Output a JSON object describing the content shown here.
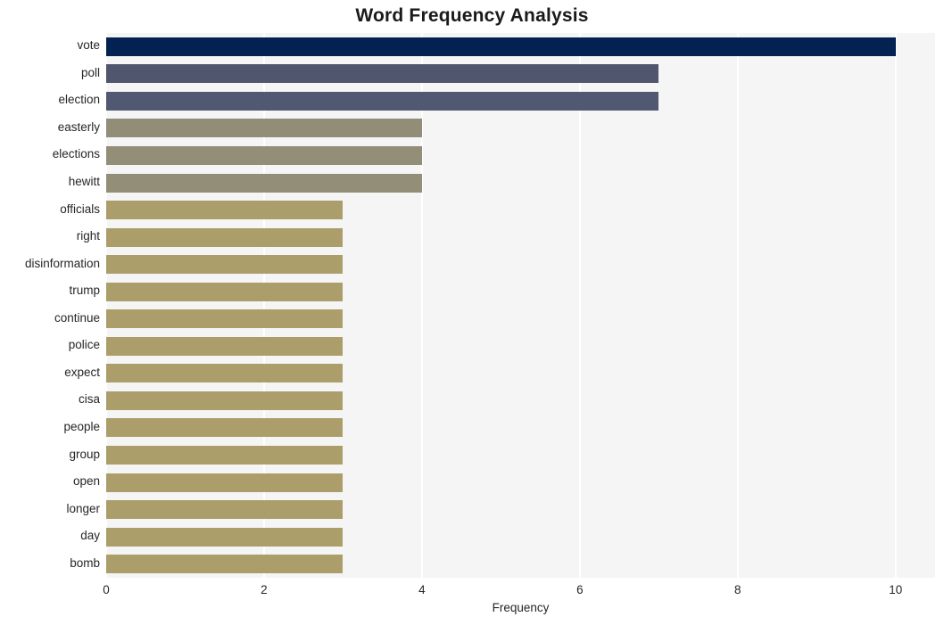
{
  "chart_data": {
    "type": "bar",
    "orientation": "horizontal",
    "title": "Word Frequency Analysis",
    "xlabel": "Frequency",
    "ylabel": "",
    "categories": [
      "vote",
      "poll",
      "election",
      "easterly",
      "elections",
      "hewitt",
      "officials",
      "right",
      "disinformation",
      "trump",
      "continue",
      "police",
      "expect",
      "cisa",
      "people",
      "group",
      "open",
      "longer",
      "day",
      "bomb"
    ],
    "values": [
      10,
      7,
      7,
      4,
      4,
      4,
      3,
      3,
      3,
      3,
      3,
      3,
      3,
      3,
      3,
      3,
      3,
      3,
      3,
      3
    ],
    "bar_colors": [
      "#032252",
      "#4f566d",
      "#515872",
      "#918d76",
      "#938e78",
      "#938e78",
      "#ab9e6b",
      "#ab9e6b",
      "#ab9e6b",
      "#ab9e6b",
      "#ab9e6b",
      "#ab9e6b",
      "#ab9e6b",
      "#ab9e6b",
      "#ab9e6b",
      "#ab9e6b",
      "#ab9e6b",
      "#ab9e6b",
      "#ab9e6b",
      "#ab9e6b"
    ],
    "xlim": [
      0,
      10.5
    ],
    "x_ticks": [
      "0",
      "2",
      "4",
      "6",
      "8",
      "10"
    ],
    "x_tick_values": [
      0,
      2,
      4,
      6,
      8,
      10
    ],
    "grid": true,
    "grid_axis": "x",
    "grid_color": "#ffffff",
    "plot_background": "#f5f5f6",
    "figure_background": "#ffffff",
    "legend": null
  }
}
